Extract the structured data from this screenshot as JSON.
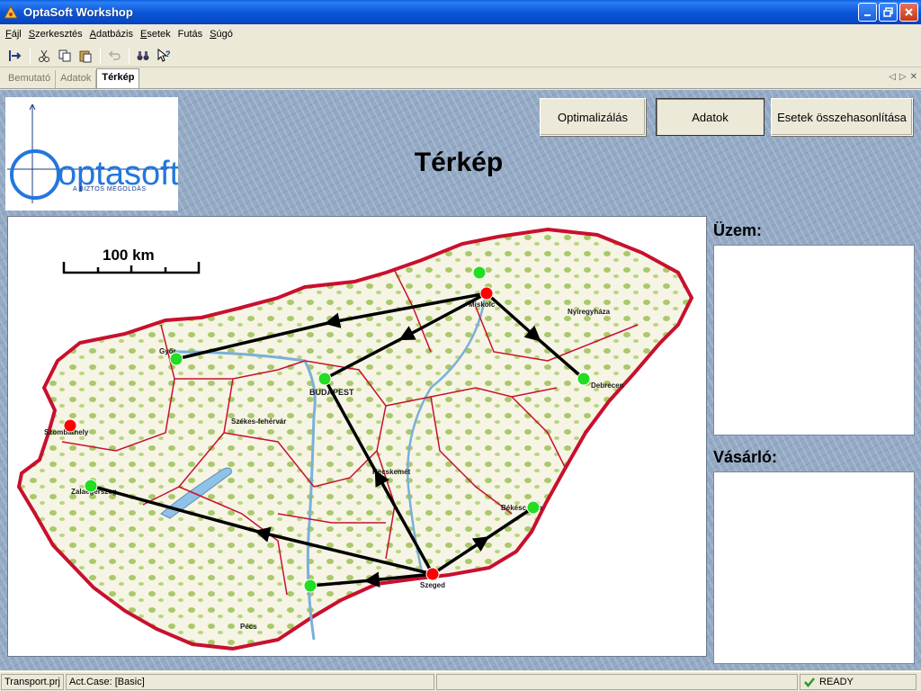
{
  "window": {
    "title": "OptaSoft Workshop"
  },
  "menu": [
    {
      "label": "Fájl",
      "accel": "F"
    },
    {
      "label": "Szerkesztés",
      "accel": "S"
    },
    {
      "label": "Adatbázis",
      "accel": "A"
    },
    {
      "label": "Esetek",
      "accel": "E"
    },
    {
      "label": "Futás",
      "accel": ""
    },
    {
      "label": "Súgó",
      "accel": "S"
    }
  ],
  "toolbar": {
    "icons": [
      "run-icon",
      "cut-icon",
      "copy-icon",
      "paste-icon",
      "undo-icon",
      "binoculars-icon",
      "help-pointer-icon"
    ]
  },
  "tabs": [
    {
      "label": "Bemutató",
      "active": false
    },
    {
      "label": "Adatok",
      "active": false
    },
    {
      "label": "Térkép",
      "active": true
    }
  ],
  "logo": {
    "name": "optasoft",
    "tagline": "A BIZTOS MEGOLDÁS"
  },
  "page": {
    "title": "Térkép"
  },
  "buttons": {
    "optimize": "Optimalizálás",
    "data": "Adatok",
    "compare": "Esetek összehasonlítása"
  },
  "map": {
    "scale_label": "100 km",
    "city_labels": [
      "BUDAPEST",
      "Debrecen",
      "Nyíregyháza",
      "Miskolc",
      "Kecskemét",
      "Pécs",
      "Székes-fehérvár",
      "Szombathely",
      "Zalaegerszeg",
      "Békéscsaba",
      "Szeged",
      "Győr"
    ]
  },
  "panels": {
    "plant_label": "Üzem:",
    "buyer_label": "Vásárló:"
  },
  "status": {
    "project": "Transport.prj",
    "case": "Act.Case: [Basic]",
    "state": "READY"
  },
  "colors": {
    "title_bar": "#0b57d8",
    "plant_node": "#ff0000",
    "customer_node": "#22dd22",
    "route": "#000000",
    "county_border": "#c8102e"
  }
}
